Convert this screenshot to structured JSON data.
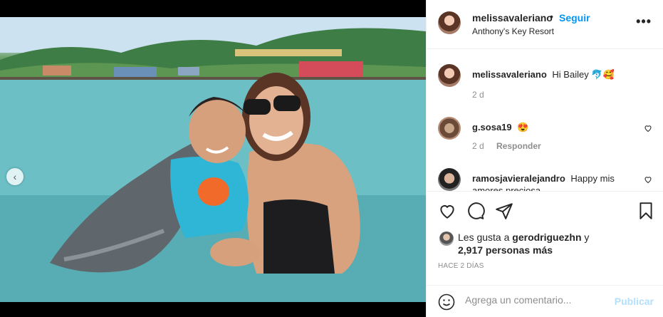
{
  "post": {
    "author": "melissavaleriano",
    "separator": "•",
    "follow_label": "Seguir",
    "location": "Anthony's Key Resort",
    "more_label": "•••"
  },
  "media": {
    "prev_label": "‹",
    "slide_count": 3,
    "active_slide": 3
  },
  "comments": [
    {
      "user": "melissavaleriano",
      "text": "Hi Bailey 🐬🥰",
      "age": "2 d",
      "reply": ""
    },
    {
      "user": "g.sosa19",
      "text": "😍",
      "age": "2 d",
      "reply": "Responder"
    },
    {
      "user": "ramosjavieralejandro",
      "text": "Happy mis amores preciosa",
      "age": "",
      "reply": ""
    }
  ],
  "likes": {
    "line1_prefix": "Les gusta a ",
    "liker": "gerodriguezhn",
    "line1_suffix": " y",
    "line2": "2,917 personas más"
  },
  "time_ago": "HACE 2 DÍAS",
  "composer": {
    "placeholder": "Agrega un comentario...",
    "publish_label": "Publicar"
  },
  "colors": {
    "accent": "#0095f6",
    "publish_disabled": "#b2dffc",
    "muted": "#8e8e8e"
  }
}
